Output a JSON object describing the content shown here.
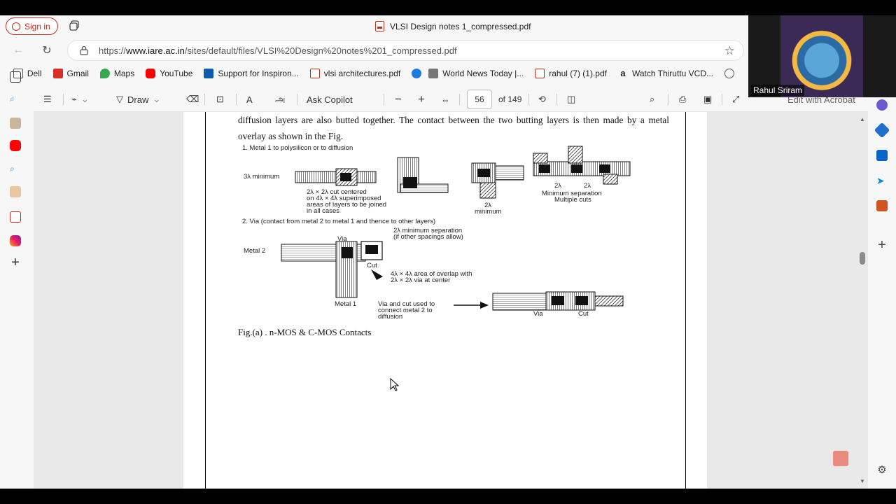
{
  "browser": {
    "signin_label": "Sign in",
    "tab_title": "VLSI Design notes 1_compressed.pdf",
    "url_prefix": "https://",
    "url_host": "www.iare.ac.in",
    "url_path": "/sites/default/files/VLSI%20Design%20notes%201_compressed.pdf"
  },
  "bookmarks": [
    {
      "label": "Dell",
      "icon": "folder-icon",
      "color": "#555555"
    },
    {
      "label": "Gmail",
      "icon": "gmail-icon",
      "color": "#d93025"
    },
    {
      "label": "Maps",
      "icon": "maps-icon",
      "color": "#34a853"
    },
    {
      "label": "YouTube",
      "icon": "youtube-icon",
      "color": "#ff0000"
    },
    {
      "label": "Support for Inspiron...",
      "icon": "dell-icon",
      "color": "#0b5cad"
    },
    {
      "label": "vlsi architectures.pdf",
      "icon": "pdf-icon",
      "color": "#c42b1c"
    },
    {
      "label": "",
      "icon": "bird-icon",
      "color": "#1f7ae0"
    },
    {
      "label": "World News Today |...",
      "icon": "news-icon",
      "color": "#777777"
    },
    {
      "label": "rahul (7) (1).pdf",
      "icon": "pdf-icon",
      "color": "#c42b1c"
    },
    {
      "label": "Watch Thiruttu VCD...",
      "icon": "amazon-icon",
      "color": "#222222"
    }
  ],
  "pdf_toolbar": {
    "draw_label": "Draw",
    "copilot_label": "Ask Copilot",
    "page_current": "56",
    "page_total": "of 149",
    "acrobat_label": "Edit with Acrobat"
  },
  "document": {
    "paragraph": "diffusion layers are also butted together. The contact between the two butting layers is then made by a metal overlay as shown in the Fig.",
    "figure_labels": {
      "l1": "1.  Metal 1 to polysilicon or to diffusion",
      "min3": "3λ minimum",
      "cut1": "2λ × 2λ cut centered",
      "cut2": "on 4λ × 4λ superimposed",
      "cut3": "areas of layers to be joined",
      "cut4": "in all cases",
      "twol": "2λ",
      "minimum": "minimum",
      "s1": "2λ",
      "s2": "2λ",
      "minsep": "Minimum separation",
      "multcuts": "Multiple cuts",
      "l2": "2.  Via (contact from metal 2 to metal 1 and thence to other layers)",
      "minsep2a": "2λ minimum separation",
      "minsep2b": "(if other spacings allow)",
      "via": "Via",
      "metal2": "Metal 2",
      "cut": "Cut",
      "ov1": "4λ × 4λ area of overlap with",
      "ov2": "2λ × 2λ via at center",
      "metal1": "Metal 1",
      "vc1": "Via and cut used to",
      "vc2": "connect metal 2 to",
      "vc3": "diffusion",
      "via2": "Via",
      "cut2l": "Cut"
    },
    "caption": "Fig.(a) . n-MOS & C-MOS Contacts"
  },
  "webcam": {
    "name": "Rahul Sriram"
  }
}
